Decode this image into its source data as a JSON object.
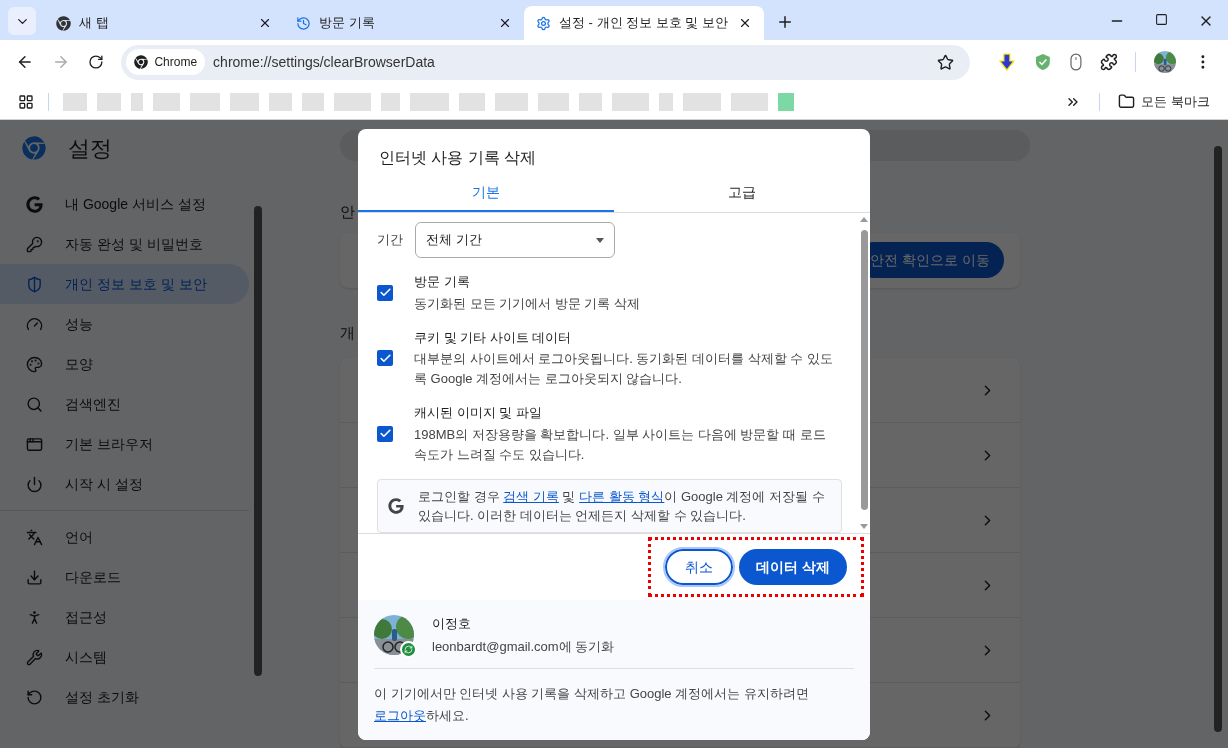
{
  "browser": {
    "tabs": [
      {
        "title": "새 탭",
        "selected": false
      },
      {
        "title": "방문 기록",
        "selected": false
      },
      {
        "title": "설정 - 개인 정보 보호 및 보안",
        "selected": true
      }
    ],
    "omnibox": {
      "chip": "Chrome",
      "url": "chrome://settings/clearBrowserData"
    },
    "bookmarks": {
      "all_bookmarks": "모든 북마크"
    }
  },
  "settings": {
    "title": "설정",
    "nav_groups": [
      [
        {
          "label": "내 Google 서비스 설정",
          "selected": false
        },
        {
          "label": "자동 완성 및 비밀번호",
          "selected": false
        },
        {
          "label": "개인 정보 보호 및 보안",
          "selected": true
        },
        {
          "label": "성능",
          "selected": false
        },
        {
          "label": "모양",
          "selected": false
        },
        {
          "label": "검색엔진",
          "selected": false
        },
        {
          "label": "기본 브라우저",
          "selected": false
        },
        {
          "label": "시작 시 설정",
          "selected": false
        }
      ],
      [
        {
          "label": "언어",
          "selected": false
        },
        {
          "label": "다운로드",
          "selected": false
        },
        {
          "label": "접근성",
          "selected": false
        },
        {
          "label": "시스템",
          "selected": false
        },
        {
          "label": "설정 초기화",
          "selected": false
        }
      ]
    ],
    "main": {
      "section_1": "안",
      "safety_check_button": "안전 확인으로 이동",
      "section_2": "개"
    }
  },
  "dialog": {
    "title": "인터넷 사용 기록 삭제",
    "tabs": [
      {
        "label": "기본",
        "selected": true
      },
      {
        "label": "고급",
        "selected": false
      }
    ],
    "time_range": {
      "label": "기간",
      "value": "전체 기간"
    },
    "options": [
      {
        "title": "방문 기록",
        "description": "동기화된 모든 기기에서 방문 기록 삭제",
        "checked": true
      },
      {
        "title": "쿠키 및 기타 사이트 데이터",
        "description": "대부분의 사이트에서 로그아웃됩니다. 동기화된 데이터를 삭제할 수 있도록 Google 계정에서는 로그아웃되지 않습니다.",
        "checked": true
      },
      {
        "title": "캐시된 이미지 및 파일",
        "description": "198MB의 저장용량을 확보합니다. 일부 사이트는 다음에 방문할 때 로드 속도가 느려질 수도 있습니다.",
        "checked": true
      }
    ],
    "info": [
      {
        "text": "로그인할 경우 ",
        "link": false
      },
      {
        "text": "검색 기록",
        "link": true
      },
      {
        "text": " 및 ",
        "link": false
      },
      {
        "text": "다른 활동 형식",
        "link": true
      },
      {
        "text": "이 Google 계정에 저장될 수 있습니다. 이러한 데이터는 언제든지 삭제할 수 있습니다.",
        "link": false
      }
    ],
    "buttons": {
      "cancel": "취소",
      "confirm": "데이터 삭제"
    },
    "account": {
      "name": "이정호",
      "sync": "leonbardt@gmail.com에 동기화"
    },
    "note": [
      {
        "text": "이 기기에서만 인터넷 사용 기록을 삭제하고 Google 계정에서는 유지하려면 ",
        "link": false
      },
      {
        "text": "로그아웃",
        "link": true
      },
      {
        "text": "하세요.",
        "link": false
      }
    ]
  }
}
